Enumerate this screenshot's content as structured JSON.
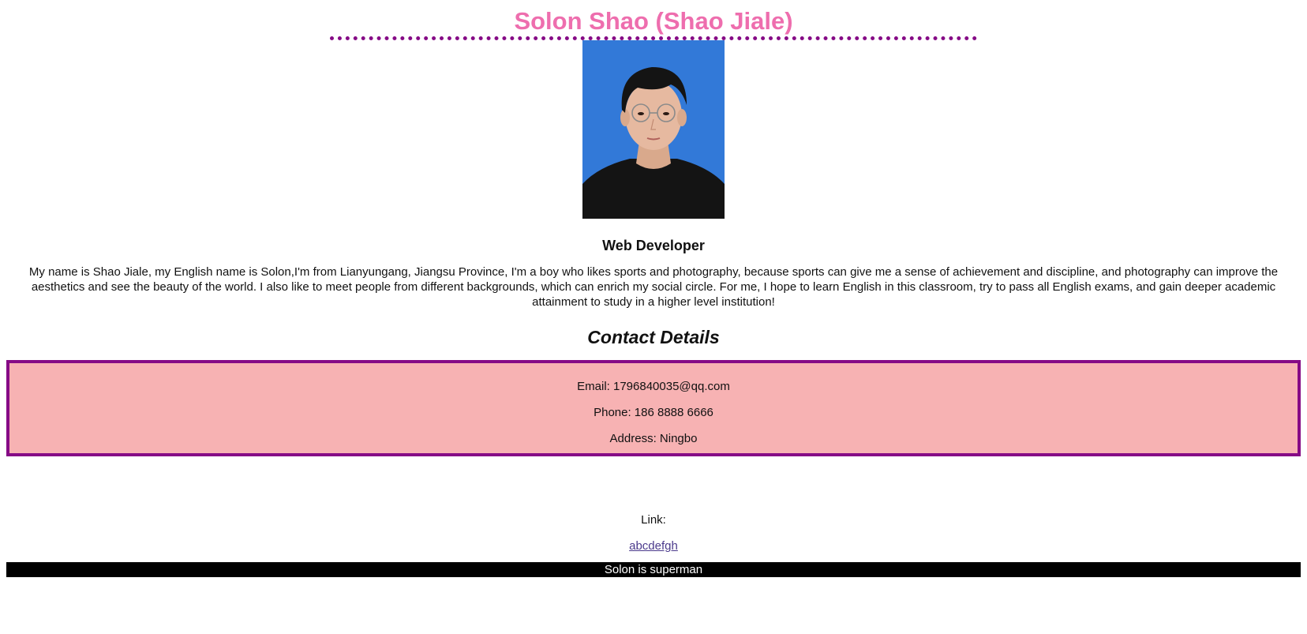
{
  "header": {
    "title": "Solon Shao (Shao Jiale)",
    "title_color": "#ee6eae",
    "rule_color": "#860b86"
  },
  "profile": {
    "photo_icon": "portrait-photo",
    "role": "Web Developer",
    "bio": "My name is Shao Jiale, my English name is Solon,I'm from Lianyungang, Jiangsu Province, I'm a boy who likes sports and photography, because sports can give me a sense of achievement and discipline, and photography can improve the aesthetics and see the beauty of the world. I also like to meet people from different backgrounds, which can enrich my social circle. For me, I hope to learn English in this classroom, try to pass all English exams, and gain deeper academic attainment to study in a higher level institution!"
  },
  "contact": {
    "heading": "Contact Details",
    "box_color": "#f7b2b3",
    "border_color": "#860b86",
    "email": "Email: 1796840035@qq.com",
    "phone": "Phone: 186 8888 6666",
    "address": "Address: Ningbo"
  },
  "links": {
    "label": "Link:",
    "anchor_text": "abcdefgh"
  },
  "footer": {
    "text": "Solon is superman"
  }
}
